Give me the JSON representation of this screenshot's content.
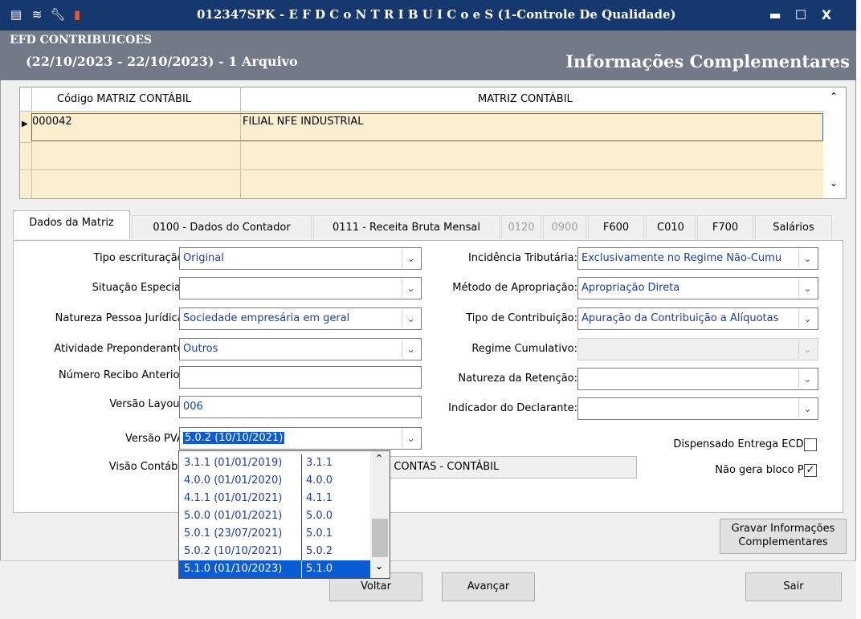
{
  "window": {
    "title": "012347SPK - E F D  C o N T R I B U I C o e S (1-Controle De Qualidade)",
    "minimize": "▬",
    "maximize": "☐",
    "close": "X"
  },
  "header": {
    "app_name": "EFD CONTRIBUICOES",
    "period": "(22/10/2023 - 22/10/2023) - 1 Arquivo",
    "section": "Informações Complementares"
  },
  "grid": {
    "columns": [
      "Código MATRIZ CONTÁBIL",
      "MATRIZ CONTÁBIL"
    ],
    "rows": [
      {
        "code": "000042",
        "name": "FILIAL NFE INDUSTRIAL"
      }
    ]
  },
  "tabs": [
    {
      "label": "Dados da Matriz",
      "state": "active"
    },
    {
      "label": "0100 - Dados do Contador",
      "state": "normal"
    },
    {
      "label": "0111 - Receita Bruta Mensal",
      "state": "normal"
    },
    {
      "label": "0120",
      "state": "disabled"
    },
    {
      "label": "0900",
      "state": "disabled"
    },
    {
      "label": "F600",
      "state": "normal"
    },
    {
      "label": "C010",
      "state": "normal"
    },
    {
      "label": "F700",
      "state": "normal"
    },
    {
      "label": "Salários",
      "state": "normal"
    }
  ],
  "form": {
    "tipo_escrituracao": {
      "label": "Tipo escrituração:",
      "value": "Original"
    },
    "situacao_especial": {
      "label": "Situação Especial:",
      "value": ""
    },
    "natureza_pj": {
      "label": "Natureza Pessoa Jurídica:",
      "value": "Sociedade empresária em geral"
    },
    "atividade": {
      "label": "Atividade Preponderante:",
      "value": "Outros"
    },
    "numero_recibo": {
      "label": "Número Recibo Anterior:",
      "value": ""
    },
    "versao_layout": {
      "label": "Versão Layout:",
      "value": "006"
    },
    "versao_pva": {
      "label": "Versão PVA:",
      "value": "5.0.2 (10/10/2021)"
    },
    "visao_contabil": {
      "label": "Visão Contábil:",
      "value": "E CONTAS - CONTÁBIL"
    },
    "incidencia": {
      "label": "Incidência Tributária:",
      "value": "Exclusivamente no Regime Não-Cumu"
    },
    "metodo": {
      "label": "Método de Apropriação:",
      "value": "Apropriação Direta"
    },
    "tipo_contribuicao": {
      "label": "Tipo de Contribuição:",
      "value": "Apuração da Contribuição a Alíquotas"
    },
    "regime_cumulativo": {
      "label": "Regime Cumulativo:",
      "value": ""
    },
    "natureza_retencao": {
      "label": "Natureza da Retenção:",
      "value": ""
    },
    "indicador_declarante": {
      "label": "Indicador do Declarante:",
      "value": ""
    },
    "dispensado_ecd": {
      "label": "Dispensado Entrega ECD:",
      "checked": false,
      "mark": ""
    },
    "nao_gera_bloco_p": {
      "label": "Não gera bloco P:",
      "checked": true,
      "mark": "✓"
    }
  },
  "pva_dropdown": {
    "options": [
      {
        "version": "3.1.1 (01/01/2019)",
        "code": "3.1.1"
      },
      {
        "version": "4.0.0 (01/01/2020)",
        "code": "4.0.0"
      },
      {
        "version": "4.1.1 (01/01/2021)",
        "code": "4.1.1"
      },
      {
        "version": "5.0.0 (01/01/2021)",
        "code": "5.0.0"
      },
      {
        "version": "5.0.1 (23/07/2021)",
        "code": "5.0.1"
      },
      {
        "version": "5.0.2 (10/10/2021)",
        "code": "5.0.2"
      },
      {
        "version": "5.1.0 (01/10/2023)",
        "code": "5.1.0"
      }
    ],
    "highlighted_index": 6
  },
  "buttons": {
    "gravar_line1": "Gravar Informações",
    "gravar_line2": "Complementares",
    "voltar": "Voltar",
    "avancar": "Avançar",
    "sair": "Sair"
  }
}
